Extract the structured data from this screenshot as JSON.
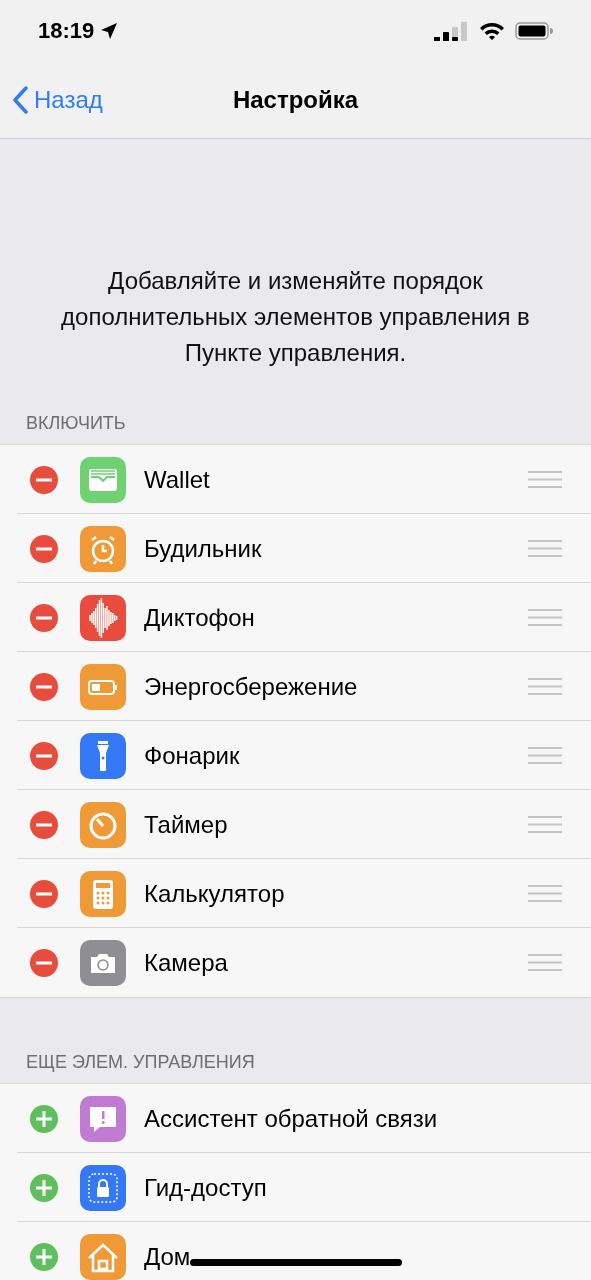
{
  "status_bar": {
    "time": "18:19"
  },
  "nav": {
    "back": "Назад",
    "title": "Настройка"
  },
  "description": "Добавляйте и изменяйте порядок дополнительных элементов управления в Пункте управления.",
  "sections": [
    {
      "header": "ВКЛЮЧИТЬ",
      "items": [
        {
          "label": "Wallet",
          "included": true,
          "kind": "wallet",
          "color": "#6dd26f"
        },
        {
          "label": "Будильник",
          "included": true,
          "kind": "alarm",
          "color": "#f09a37"
        },
        {
          "label": "Диктофон",
          "included": true,
          "kind": "wave",
          "color": "#e94b3c"
        },
        {
          "label": "Энергосбережение",
          "included": true,
          "kind": "battery",
          "color": "#f09a37"
        },
        {
          "label": "Фонарик",
          "included": true,
          "kind": "flashlight",
          "color": "#3478f6"
        },
        {
          "label": "Таймер",
          "included": true,
          "kind": "timer",
          "color": "#f09a37"
        },
        {
          "label": "Калькулятор",
          "included": true,
          "kind": "calculator",
          "color": "#f09a37"
        },
        {
          "label": "Камера",
          "included": true,
          "kind": "camera",
          "color": "#8e8e93"
        }
      ]
    },
    {
      "header": "ЕЩЕ ЭЛЕМ. УПРАВЛЕНИЯ",
      "items": [
        {
          "label": "Ассистент обратной связи",
          "included": false,
          "kind": "feedback",
          "color": "#c27bd3"
        },
        {
          "label": "Гид-доступ",
          "included": false,
          "kind": "lock",
          "color": "#3478f6"
        },
        {
          "label": "Дом",
          "included": false,
          "kind": "home",
          "color": "#f09a37"
        }
      ]
    }
  ]
}
